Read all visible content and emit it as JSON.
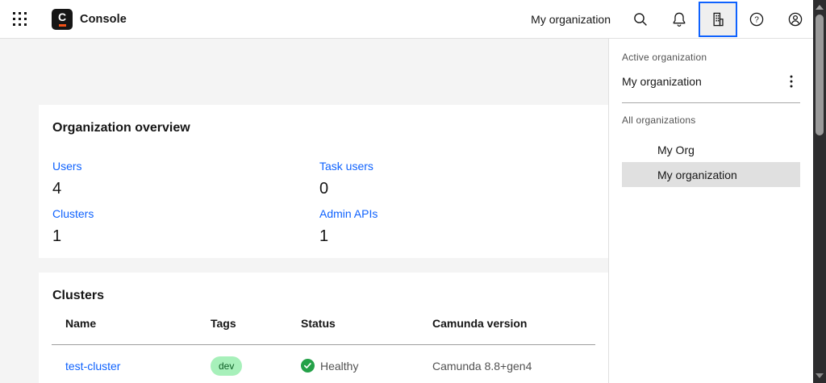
{
  "nav": {
    "product_name": "Console",
    "logo_letter": "C",
    "org_label": "My organization"
  },
  "org_panel": {
    "active_section_label": "Active organization",
    "active_org_name": "My organization",
    "all_section_label": "All organizations",
    "organizations": [
      {
        "name": "My Org",
        "active": false
      },
      {
        "name": "My organization",
        "active": true
      }
    ]
  },
  "overview": {
    "title": "Organization overview",
    "stats": [
      {
        "label": "Users",
        "value": "4"
      },
      {
        "label": "Task users",
        "value": "0"
      },
      {
        "label": "Clusters",
        "value": "1"
      },
      {
        "label": "Admin APIs",
        "value": "1"
      }
    ]
  },
  "clusters": {
    "title": "Clusters",
    "columns": [
      "Name",
      "Tags",
      "Status",
      "Camunda version"
    ],
    "rows": [
      {
        "name": "test-cluster",
        "tag": "dev",
        "status": "Healthy",
        "version": "Camunda 8.8+gen4"
      }
    ]
  },
  "icons": {
    "app_switcher": "grid-of-dots",
    "search": "magnifier",
    "notifications": "bell",
    "organization": "enterprise-building",
    "help": "question-circle",
    "profile": "user-circle",
    "overflow_menu": "kebab-vertical",
    "healthy": "check-circle"
  },
  "colors": {
    "accent_blue": "#0f62fe",
    "link_blue": "#0f62fe",
    "healthy_green": "#24a148",
    "tag_bg_green": "#a7f0ba",
    "tag_text_green": "#0e6027",
    "logo_orange": "#f25117",
    "selected_row_gray": "#e0e0e0",
    "page_bg": "#f4f4f4"
  }
}
